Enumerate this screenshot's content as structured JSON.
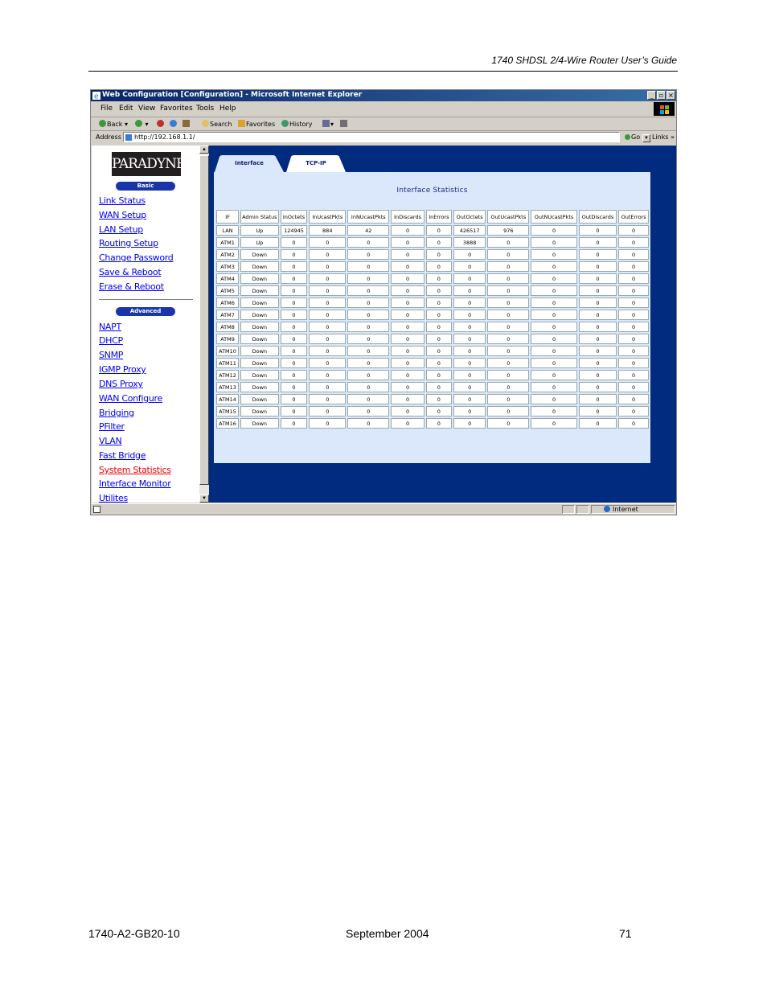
{
  "document": {
    "header": "1740 SHDSL 2/4-Wire Router User’s Guide",
    "footer_left": "1740-A2-GB20-10",
    "footer_center": "September 2004",
    "footer_right": "71"
  },
  "window": {
    "title": "Web Configuration [Configuration] - Microsoft Internet Explorer",
    "buttons": {
      "minimize": "_",
      "maximize": "▫",
      "close": "×"
    }
  },
  "menu": [
    "File",
    "Edit",
    "View",
    "Favorites",
    "Tools",
    "Help"
  ],
  "toolbar": {
    "back": "Back",
    "search": "Search",
    "favorites": "Favorites",
    "history": "History"
  },
  "address": {
    "label": "Address",
    "url": "http://192.168.1.1/",
    "go": "Go",
    "links": "Links"
  },
  "sidebar": {
    "logo": "PARADYNE",
    "basic_label": "Basic",
    "advanced_label": "Advanced",
    "basic_items": [
      "Link Status",
      "WAN Setup",
      "LAN Setup",
      "Routing Setup",
      "Change Password",
      "Save & Reboot",
      "Erase & Reboot"
    ],
    "advanced_items": [
      "NAPT",
      "DHCP",
      "SNMP",
      "IGMP Proxy",
      "DNS Proxy",
      "WAN Configure",
      "Bridging",
      "PFilter",
      "VLAN",
      "Fast Bridge",
      "System Statistics",
      "Interface Monitor",
      "Utilites"
    ],
    "active_item": "System Statistics"
  },
  "tabs": [
    {
      "label": "Interface",
      "active": true
    },
    {
      "label": "TCP-IP",
      "active": false
    }
  ],
  "panel": {
    "title": "Interface Statistics",
    "columns": [
      "IF",
      "Admin Status",
      "InOctets",
      "InUcastPkts",
      "InNUcastPkts",
      "InDiscards",
      "InErrors",
      "OutOctets",
      "OutUcastPkts",
      "OutNUcastPkts",
      "OutDiscards",
      "OutErrors"
    ],
    "rows": [
      [
        "LAN",
        "Up",
        "124945",
        "884",
        "42",
        "0",
        "0",
        "426517",
        "976",
        "0",
        "0",
        "0"
      ],
      [
        "ATM1",
        "Up",
        "0",
        "0",
        "0",
        "0",
        "0",
        "3888",
        "0",
        "0",
        "0",
        "0"
      ],
      [
        "ATM2",
        "Down",
        "0",
        "0",
        "0",
        "0",
        "0",
        "0",
        "0",
        "0",
        "0",
        "0"
      ],
      [
        "ATM3",
        "Down",
        "0",
        "0",
        "0",
        "0",
        "0",
        "0",
        "0",
        "0",
        "0",
        "0"
      ],
      [
        "ATM4",
        "Down",
        "0",
        "0",
        "0",
        "0",
        "0",
        "0",
        "0",
        "0",
        "0",
        "0"
      ],
      [
        "ATM5",
        "Down",
        "0",
        "0",
        "0",
        "0",
        "0",
        "0",
        "0",
        "0",
        "0",
        "0"
      ],
      [
        "ATM6",
        "Down",
        "0",
        "0",
        "0",
        "0",
        "0",
        "0",
        "0",
        "0",
        "0",
        "0"
      ],
      [
        "ATM7",
        "Down",
        "0",
        "0",
        "0",
        "0",
        "0",
        "0",
        "0",
        "0",
        "0",
        "0"
      ],
      [
        "ATM8",
        "Down",
        "0",
        "0",
        "0",
        "0",
        "0",
        "0",
        "0",
        "0",
        "0",
        "0"
      ],
      [
        "ATM9",
        "Down",
        "0",
        "0",
        "0",
        "0",
        "0",
        "0",
        "0",
        "0",
        "0",
        "0"
      ],
      [
        "ATM10",
        "Down",
        "0",
        "0",
        "0",
        "0",
        "0",
        "0",
        "0",
        "0",
        "0",
        "0"
      ],
      [
        "ATM11",
        "Down",
        "0",
        "0",
        "0",
        "0",
        "0",
        "0",
        "0",
        "0",
        "0",
        "0"
      ],
      [
        "ATM12",
        "Down",
        "0",
        "0",
        "0",
        "0",
        "0",
        "0",
        "0",
        "0",
        "0",
        "0"
      ],
      [
        "ATM13",
        "Down",
        "0",
        "0",
        "0",
        "0",
        "0",
        "0",
        "0",
        "0",
        "0",
        "0"
      ],
      [
        "ATM14",
        "Down",
        "0",
        "0",
        "0",
        "0",
        "0",
        "0",
        "0",
        "0",
        "0",
        "0"
      ],
      [
        "ATM15",
        "Down",
        "0",
        "0",
        "0",
        "0",
        "0",
        "0",
        "0",
        "0",
        "0",
        "0"
      ],
      [
        "ATM16",
        "Down",
        "0",
        "0",
        "0",
        "0",
        "0",
        "0",
        "0",
        "0",
        "0",
        "0"
      ]
    ]
  },
  "statusbar": {
    "zone": "Internet"
  },
  "colors": {
    "titlebar": "#0a246a",
    "content_background": "#002b7f",
    "panel": "#dbe8fb",
    "link": "#0000ee",
    "active_link": "#ee0000",
    "pill": "#1a35a8"
  }
}
